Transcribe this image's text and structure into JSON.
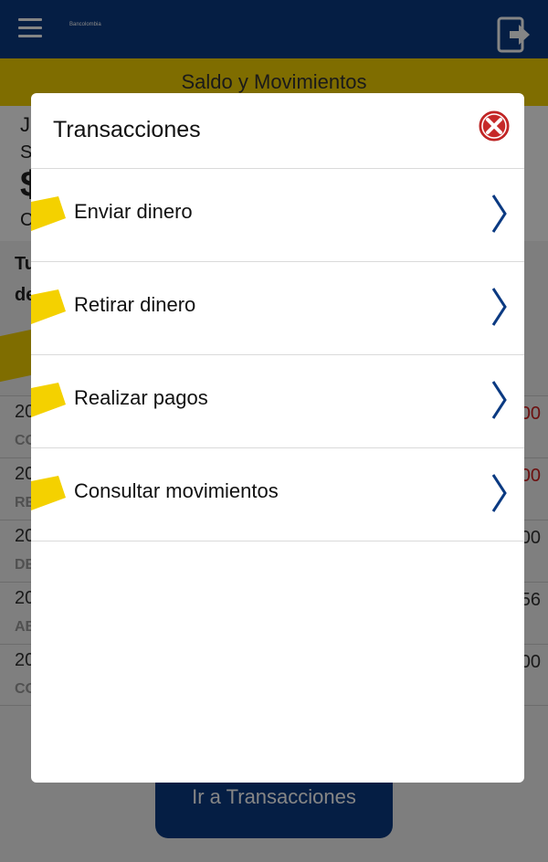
{
  "app": {
    "brand_logo_text": "Bancolombia",
    "section_title": "Saldo y Movimientos"
  },
  "account": {
    "line1": "J",
    "line2": "S",
    "line3": "$",
    "line4": "C"
  },
  "background": {
    "heading_line1": "Tu",
    "heading_line2": "de",
    "movements": [
      {
        "date": "20",
        "desc": "CO",
        "amount": "00",
        "negative": true
      },
      {
        "date": "20",
        "desc": "RE",
        "amount": "00",
        "negative": true
      },
      {
        "date": "20",
        "desc": "DE",
        "amount": "00",
        "negative": false
      },
      {
        "date": "20",
        "desc": "AB",
        "amount": "56",
        "negative": false
      },
      {
        "date": "20",
        "desc": "CO",
        "amount": "00",
        "negative": false
      }
    ],
    "ir_button_label": "Ir a Transacciones"
  },
  "modal": {
    "title": "Transacciones",
    "items": [
      {
        "label": "Enviar dinero"
      },
      {
        "label": "Retirar dinero"
      },
      {
        "label": "Realizar pagos"
      },
      {
        "label": "Consultar movimientos"
      }
    ]
  },
  "colors": {
    "brand_blue": "#0b3a82",
    "brand_yellow": "#f4d100",
    "close_red": "#c62828",
    "negative_red": "#d0201f"
  },
  "icons": {
    "menu": "hamburger-icon",
    "logout": "logout-icon",
    "close": "close-circle-icon",
    "chevron": "chevron-right-icon",
    "tag": "yellow-tag-icon"
  }
}
